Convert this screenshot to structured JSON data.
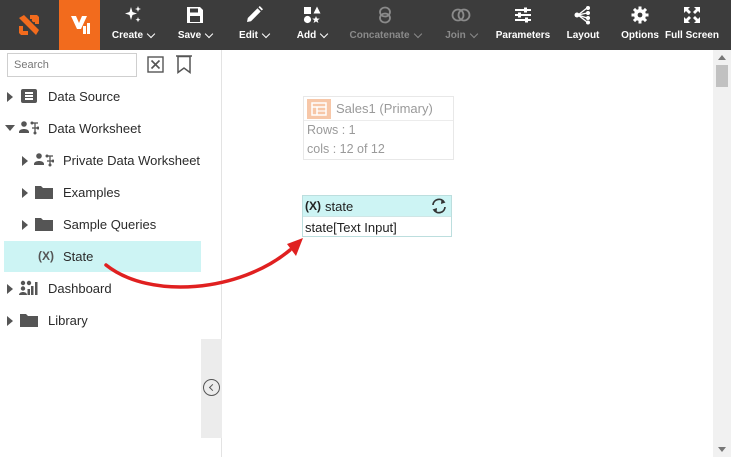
{
  "toolbar": {
    "buttons": [
      {
        "label": "Create",
        "icon": "sparkle-icon",
        "dropdown": true,
        "enabled": true
      },
      {
        "label": "Save",
        "icon": "floppy-disk-icon",
        "dropdown": true,
        "enabled": true
      },
      {
        "label": "Edit",
        "icon": "pencil-icon",
        "dropdown": true,
        "enabled": true
      },
      {
        "label": "Add",
        "icon": "shapes-icon",
        "dropdown": true,
        "enabled": true
      },
      {
        "label": "Concatenate",
        "icon": "concatenate-icon",
        "dropdown": true,
        "enabled": false
      },
      {
        "label": "Join",
        "icon": "join-icon",
        "dropdown": true,
        "enabled": false
      },
      {
        "label": "Parameters",
        "icon": "sliders-icon",
        "dropdown": false,
        "enabled": true
      },
      {
        "label": "Layout",
        "icon": "layout-tree-icon",
        "dropdown": false,
        "enabled": true
      },
      {
        "label": "Options",
        "icon": "gear-icon",
        "dropdown": false,
        "enabled": true
      },
      {
        "label": "Full Screen",
        "icon": "expand-icon",
        "dropdown": false,
        "enabled": true
      }
    ],
    "logo_vi_text": "Vi"
  },
  "sidebar": {
    "search_placeholder": "Search",
    "tree": [
      {
        "label": "Data Source",
        "icon": "data-source-icon",
        "expanded": false,
        "level": 0
      },
      {
        "label": "Data Worksheet",
        "icon": "worksheet-icon",
        "expanded": true,
        "level": 0
      },
      {
        "label": "Private Data Worksheet",
        "icon": "private-worksheet-icon",
        "expanded": false,
        "level": 1
      },
      {
        "label": "Examples",
        "icon": "folder-icon",
        "expanded": false,
        "level": 1
      },
      {
        "label": "Sample Queries",
        "icon": "folder-icon",
        "expanded": false,
        "level": 1
      },
      {
        "label": "State",
        "icon": "variable-icon",
        "level": 1,
        "selected": true,
        "icon_text": "(X)"
      },
      {
        "label": "Dashboard",
        "icon": "dashboard-icon",
        "expanded": false,
        "level": 0
      },
      {
        "label": "Library",
        "icon": "folder-icon",
        "expanded": false,
        "level": 0
      }
    ]
  },
  "canvas": {
    "table_block": {
      "title": "Sales1 (Primary)",
      "rows": "Rows : 1",
      "cols": "cols : 12 of 12"
    },
    "variable_block": {
      "icon_text": "(X)",
      "title": "state",
      "value": "state[Text Input]"
    }
  },
  "colors": {
    "toolbar_bg": "#3c3c3c",
    "accent_orange": "#f26b1d",
    "selection_cyan": "#cdf4f4",
    "annotation_red": "#e02020"
  }
}
